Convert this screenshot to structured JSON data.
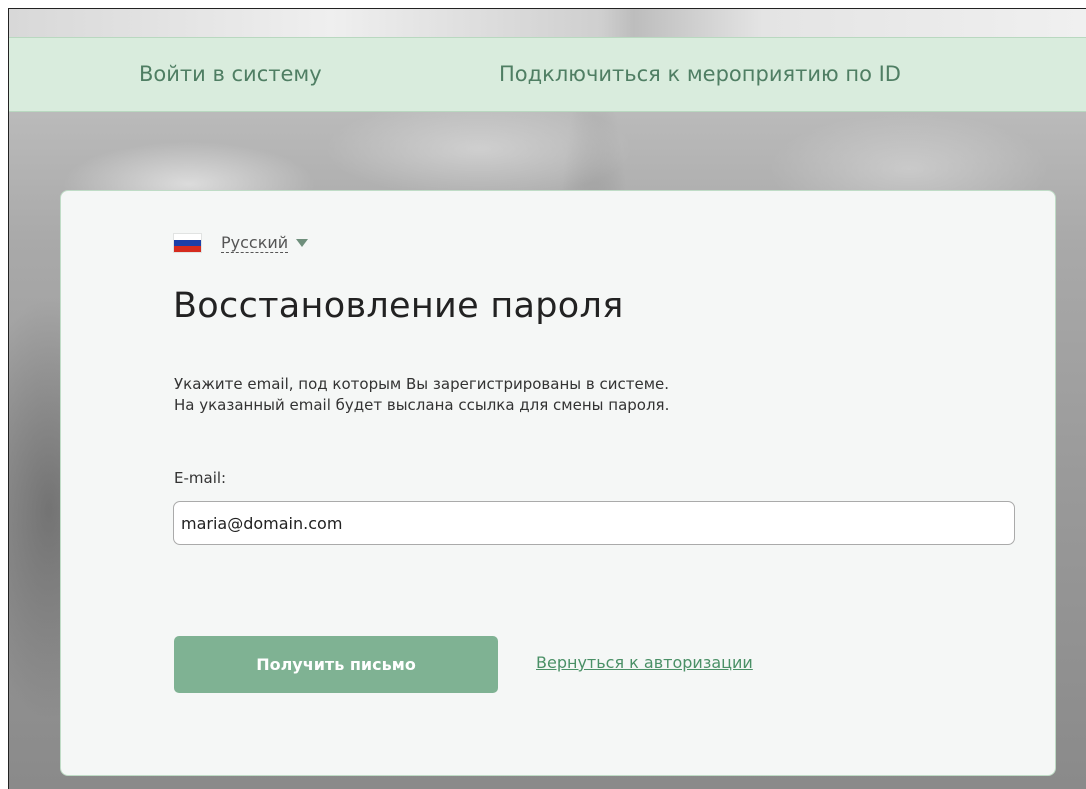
{
  "nav": {
    "login": "Войти в систему",
    "connect_by_id": "Подключиться к мероприятию по ID"
  },
  "language": {
    "label": "Русский",
    "flag": "russia-flag-icon"
  },
  "form": {
    "title": "Восстановление пароля",
    "description_line1": "Укажите email, под которым Вы зарегистрированы в системе.",
    "description_line2": "На указанный email будет выслана ссылка для смены пароля.",
    "email_label": "E-mail:",
    "email_value": "maria@domain.com",
    "submit_label": "Получить письмо",
    "back_link": "Вернуться к авторизации"
  },
  "colors": {
    "nav_background": "#d9ecdd",
    "accent": "#7fb293",
    "link": "#4a9066"
  }
}
